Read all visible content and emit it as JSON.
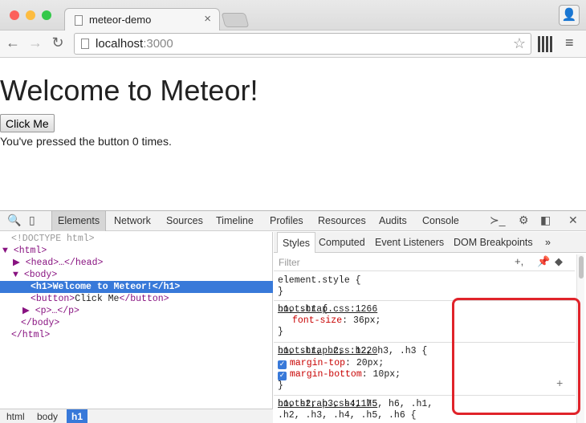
{
  "browser": {
    "tab_title": "meteor-demo",
    "url_host": "localhost",
    "url_port": ":3000",
    "traffic_lights": [
      "#fc605b",
      "#fdbc40",
      "#34c84a"
    ]
  },
  "page": {
    "heading": "Welcome to Meteor!",
    "button_label": "Click Me",
    "counter_text": "You've pressed the button 0 times."
  },
  "devtools": {
    "tabs": [
      "Elements",
      "Network",
      "Sources",
      "Timeline",
      "Profiles",
      "Resources",
      "Audits",
      "Console"
    ],
    "dom_lines": {
      "doctype": "<!DOCTYPE html>",
      "html_open": "<html>",
      "head": "<head>…</head>",
      "body_open": "<body>",
      "h1": "<h1>Welcome to Meteor!</h1>",
      "button_open": "<button>",
      "button_text": "Click Me",
      "button_close": "</button>",
      "p": "<p>…</p>",
      "body_close": "</body>",
      "html_close": "</html>"
    },
    "breadcrumbs": [
      "html",
      "body",
      "h1"
    ],
    "styles_tabs": [
      "Styles",
      "Computed",
      "Event Listeners",
      "DOM Breakpoints",
      "»"
    ],
    "filter_placeholder": "Filter",
    "rules": [
      {
        "selector": "element.style {",
        "close": "}",
        "source": ""
      },
      {
        "selector": "h1, .h1 {",
        "prop": "font-size",
        "value": "36px;",
        "close": "}",
        "source": "bootstrap.css:1266"
      },
      {
        "selector": "h1, .h1, h2, .h2, h3, .h3 {",
        "prop1": "margin-top",
        "value1": "20px;",
        "prop2": "margin-bottom",
        "value2": "10px;",
        "close": "}",
        "source": "bootstrap.css:1220"
      },
      {
        "selector": "h1, h2, h3, h4, h5, h6, .h1,",
        "selector2": ".h2, .h3, .h4, .h5, .h6 {",
        "source": "bootstrap.css:1175"
      }
    ]
  }
}
